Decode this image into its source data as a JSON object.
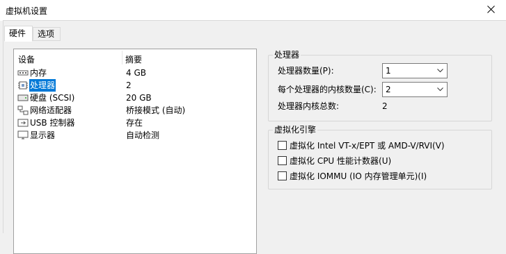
{
  "window": {
    "title": "虚拟机设置"
  },
  "tabs": [
    {
      "label": "硬件"
    },
    {
      "label": "选项"
    }
  ],
  "device_list": {
    "columns": {
      "device": "设备",
      "summary": "摘要"
    },
    "rows": [
      {
        "name": "内存",
        "summary": "4 GB",
        "icon": "memory-icon"
      },
      {
        "name": "处理器",
        "summary": "2",
        "icon": "processor-icon"
      },
      {
        "name": "硬盘 (SCSI)",
        "summary": "20 GB",
        "icon": "hard-disk-icon"
      },
      {
        "name": "网络适配器",
        "summary": "桥接模式 (自动)",
        "icon": "network-adapter-icon"
      },
      {
        "name": "USB 控制器",
        "summary": "存在",
        "icon": "usb-controller-icon"
      },
      {
        "name": "显示器",
        "summary": "自动检测",
        "icon": "display-icon"
      }
    ],
    "selected_index": 1
  },
  "processors": {
    "title": "处理器",
    "count_label": "处理器数量(P):",
    "count_value": "1",
    "cores_label": "每个处理器的内核数量(C):",
    "cores_value": "2",
    "total_label": "处理器内核总数:",
    "total_value": "2"
  },
  "virtualization": {
    "title": "虚拟化引擎",
    "options": [
      {
        "label": "虚拟化 Intel VT-x/EPT 或 AMD-V/RVI(V)",
        "checked": false
      },
      {
        "label": "虚拟化 CPU 性能计数器(U)",
        "checked": false
      },
      {
        "label": "虚拟化 IOMMU (IO 内存管理单元)(I)",
        "checked": false
      }
    ]
  },
  "colors": {
    "selection": "#0078d7",
    "dialog_bg": "#f0f0f0"
  }
}
